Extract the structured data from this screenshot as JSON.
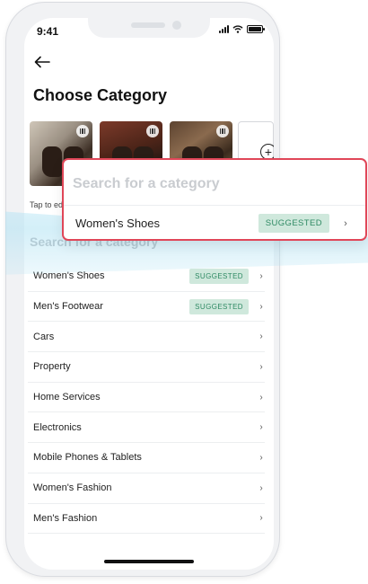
{
  "status_bar": {
    "time": "9:41"
  },
  "header": {
    "title": "Choose Category"
  },
  "photos": {
    "edit_hint": "Tap to edi"
  },
  "search": {
    "placeholder": "Search for a category"
  },
  "categories": [
    {
      "label": "Women's Shoes",
      "badge": "SUGGESTED"
    },
    {
      "label": "Men's Footwear",
      "badge": "SUGGESTED"
    },
    {
      "label": "Cars"
    },
    {
      "label": "Property"
    },
    {
      "label": "Home Services"
    },
    {
      "label": "Electronics"
    },
    {
      "label": "Mobile Phones & Tablets"
    },
    {
      "label": "Women's Fashion"
    },
    {
      "label": "Men's Fashion"
    }
  ],
  "callout": {
    "search_placeholder": "Search for a category",
    "row_label": "Women's Shoes",
    "row_badge": "SUGGESTED"
  },
  "colors": {
    "badge_bg": "#cfe8dc",
    "badge_text": "#2f8a64",
    "callout_border": "#e04658",
    "highlight": "#b0e2f3"
  },
  "icons": {
    "back": "arrow-left-icon",
    "chevron": "chevron-right-icon",
    "add_photo": "plus-circle-icon"
  }
}
